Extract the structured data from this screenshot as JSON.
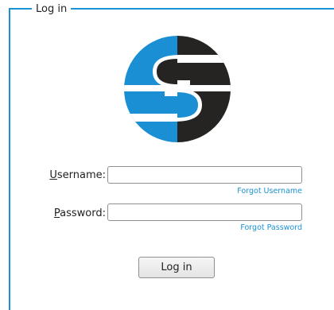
{
  "form": {
    "legend": "Log in",
    "username_access_key": "U",
    "username_label_rest": "sername:",
    "username_value": "",
    "forgot_username": "Forgot Username",
    "password_access_key": "P",
    "password_label_rest": "assword:",
    "password_value": "",
    "forgot_password": "Forgot Password",
    "submit_label": "Log in"
  },
  "logo": {
    "icon": "s-logo-icon",
    "colors": {
      "blue": "#1a8fd3",
      "dark": "#252422"
    }
  },
  "theme": {
    "accent": "#1a93d4",
    "link": "#1a93d4"
  }
}
